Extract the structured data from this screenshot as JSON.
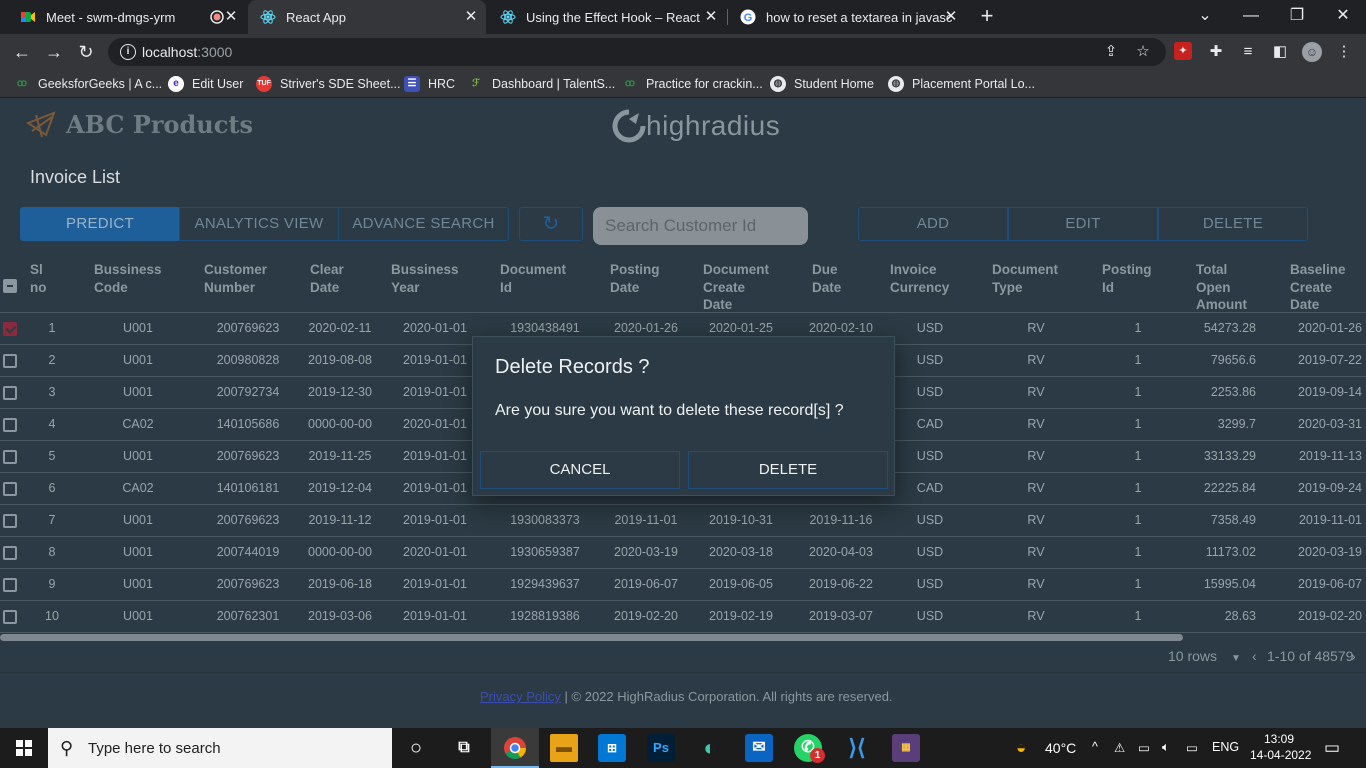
{
  "browser": {
    "tabs": [
      {
        "title": "Meet - swm-dmgs-yrm"
      },
      {
        "title": "React App"
      },
      {
        "title": "Using the Effect Hook – React"
      },
      {
        "title": "how to reset a textarea in javascri"
      }
    ],
    "url_host": "localhost",
    "url_port": ":3000",
    "bookmarks": [
      "GeeksforGeeks | A c...",
      "Edit User",
      "Striver's SDE Sheet...",
      "HRC",
      "Dashboard | TalentS...",
      "Practice for crackin...",
      "Student Home",
      "Placement Portal Lo..."
    ]
  },
  "app": {
    "brand": "ABC Products",
    "partner_logo": "highradius",
    "page_title": "Invoice List",
    "toolbar": {
      "predict": "PREDICT",
      "analytics": "ANALYTICS VIEW",
      "advance_search": "ADVANCE SEARCH",
      "search_placeholder": "Search Customer Id",
      "add": "ADD",
      "edit": "EDIT",
      "delete": "DELETE"
    },
    "columns": [
      [
        "Sl",
        "no"
      ],
      [
        "Bussiness",
        "Code"
      ],
      [
        "Customer",
        "Number"
      ],
      [
        "Clear",
        "Date"
      ],
      [
        "Bussiness",
        "Year"
      ],
      [
        "Document",
        "Id"
      ],
      [
        "Posting",
        "Date"
      ],
      [
        "Document",
        "Create",
        "Date"
      ],
      [
        "Due",
        "Date"
      ],
      [
        "Invoice",
        "Currency"
      ],
      [
        "Document",
        "Type"
      ],
      [
        "Posting",
        "Id"
      ],
      [
        "Total",
        "Open",
        "Amount"
      ],
      [
        "Baseline",
        "Create",
        "Date"
      ]
    ],
    "rows": [
      {
        "checked": true,
        "cells": [
          "1",
          "U001",
          "200769623",
          "2020-02-11",
          "2020-01-01",
          "1930438491",
          "2020-01-26",
          "2020-01-25",
          "2020-02-10",
          "USD",
          "RV",
          "1",
          "54273.28",
          "2020-01-26"
        ]
      },
      {
        "checked": false,
        "cells": [
          "2",
          "U001",
          "200980828",
          "2019-08-08",
          "2019-01-01",
          "",
          "",
          "",
          "",
          "USD",
          "RV",
          "1",
          "79656.6",
          "2019-07-22"
        ]
      },
      {
        "checked": false,
        "cells": [
          "3",
          "U001",
          "200792734",
          "2019-12-30",
          "2019-01-01",
          "",
          "",
          "",
          "",
          "USD",
          "RV",
          "1",
          "2253.86",
          "2019-09-14"
        ]
      },
      {
        "checked": false,
        "cells": [
          "4",
          "CA02",
          "140105686",
          "0000-00-00",
          "2020-01-01",
          "",
          "",
          "",
          "",
          "CAD",
          "RV",
          "1",
          "3299.7",
          "2020-03-31"
        ]
      },
      {
        "checked": false,
        "cells": [
          "5",
          "U001",
          "200769623",
          "2019-11-25",
          "2019-01-01",
          "",
          "",
          "",
          "",
          "USD",
          "RV",
          "1",
          "33133.29",
          "2019-11-13"
        ]
      },
      {
        "checked": false,
        "cells": [
          "6",
          "CA02",
          "140106181",
          "2019-12-04",
          "2019-01-01",
          "",
          "",
          "",
          "",
          "CAD",
          "RV",
          "1",
          "22225.84",
          "2019-09-24"
        ]
      },
      {
        "checked": false,
        "cells": [
          "7",
          "U001",
          "200769623",
          "2019-11-12",
          "2019-01-01",
          "1930083373",
          "2019-11-01",
          "2019-10-31",
          "2019-11-16",
          "USD",
          "RV",
          "1",
          "7358.49",
          "2019-11-01"
        ]
      },
      {
        "checked": false,
        "cells": [
          "8",
          "U001",
          "200744019",
          "0000-00-00",
          "2020-01-01",
          "1930659387",
          "2020-03-19",
          "2020-03-18",
          "2020-04-03",
          "USD",
          "RV",
          "1",
          "11173.02",
          "2020-03-19"
        ]
      },
      {
        "checked": false,
        "cells": [
          "9",
          "U001",
          "200769623",
          "2019-06-18",
          "2019-01-01",
          "1929439637",
          "2019-06-07",
          "2019-06-05",
          "2019-06-22",
          "USD",
          "RV",
          "1",
          "15995.04",
          "2019-06-07"
        ]
      },
      {
        "checked": false,
        "cells": [
          "10",
          "U001",
          "200762301",
          "2019-03-06",
          "2019-01-01",
          "1928819386",
          "2019-02-20",
          "2019-02-19",
          "2019-03-07",
          "USD",
          "RV",
          "1",
          "28.63",
          "2019-02-20"
        ]
      }
    ],
    "pagination": {
      "rows_per_page": "10 rows",
      "range": "1-10 of 48579"
    },
    "footer": {
      "link": "Privacy Policy",
      "text": " | © 2022 HighRadius Corporation. All rights are reserved."
    },
    "dialog": {
      "title": "Delete Records ?",
      "message": "Are you sure you want to delete these record[s] ?",
      "cancel": "CANCEL",
      "confirm": "DELETE"
    }
  },
  "taskbar": {
    "search_placeholder": "Type here to search",
    "weather": "40°C",
    "lang": "ENG",
    "time": "13:09",
    "date": "14-04-2022",
    "whatsapp_badge": "1"
  }
}
